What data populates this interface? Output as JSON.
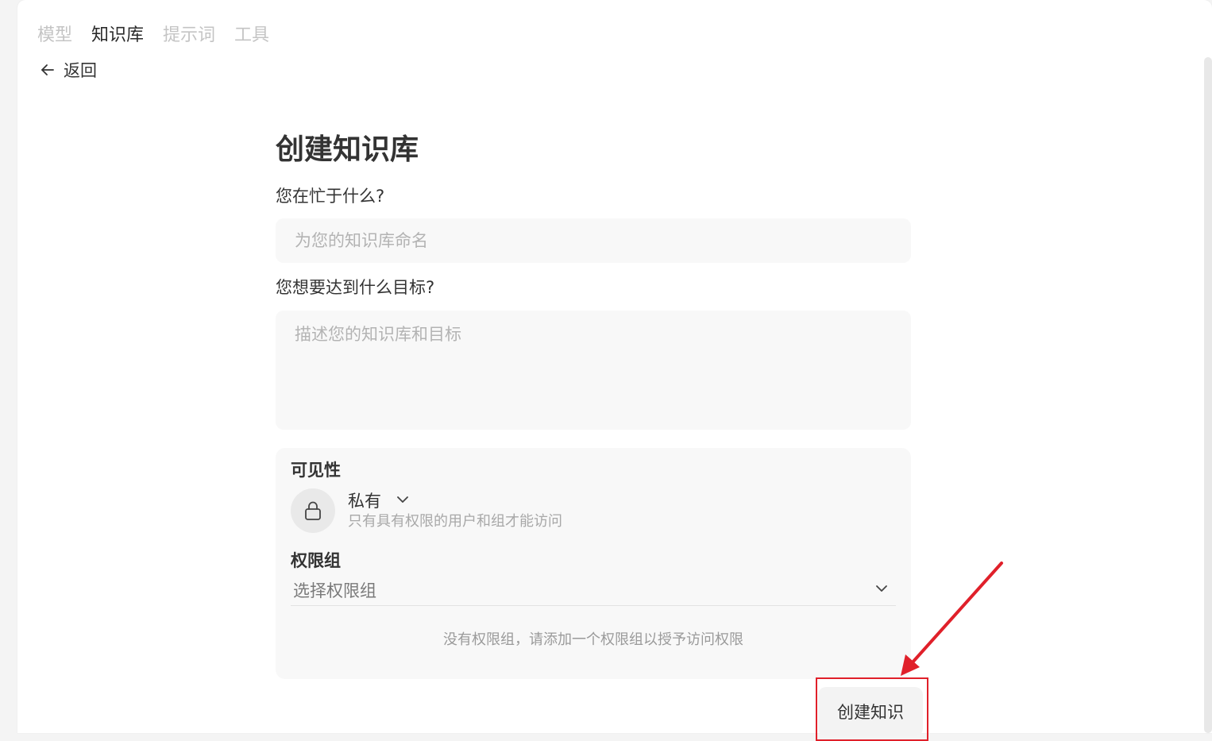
{
  "tabs": [
    {
      "label": "模型",
      "active": false
    },
    {
      "label": "知识库",
      "active": true
    },
    {
      "label": "提示词",
      "active": false
    },
    {
      "label": "工具",
      "active": false
    }
  ],
  "back": {
    "label": "返回",
    "icon": "arrow-left-icon"
  },
  "form": {
    "title": "创建知识库",
    "name_label": "您在忙于什么?",
    "name_placeholder": "为您的知识库命名",
    "name_value": "",
    "goal_label": "您想要达到什么目标?",
    "goal_placeholder": "描述您的知识库和目标",
    "goal_value": ""
  },
  "visibility": {
    "title": "可见性",
    "icon": "lock-icon",
    "value": "私有",
    "description": "只有具有权限的用户和组才能访问"
  },
  "permissions": {
    "title": "权限组",
    "placeholder": "选择权限组",
    "empty_message": "没有权限组，请添加一个权限组以授予访问权限"
  },
  "create_button": {
    "label": "创建知识"
  },
  "colors": {
    "highlight": "#e0202a",
    "tab_inactive": "#c4c4c4",
    "tab_active": "#2b2b2b"
  }
}
